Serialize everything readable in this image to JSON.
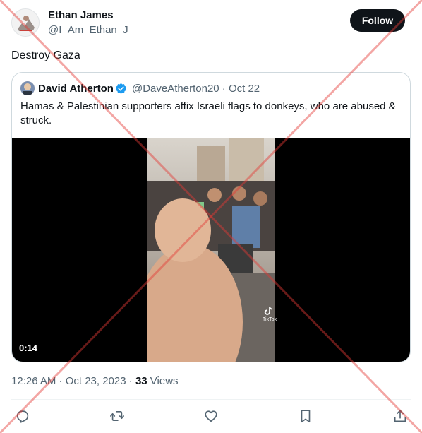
{
  "author": {
    "display_name": "Ethan James",
    "handle": "@I_Am_Ethan_J"
  },
  "follow_label": "Follow",
  "tweet_text": "Destroy Gaza",
  "quoted": {
    "display_name": "David Atherton",
    "handle_and_date": "@DaveAtherton20 · Oct 22",
    "text": "Hamas & Palestinian supporters affix Israeli flags to donkeys, who are abused & struck.",
    "video": {
      "duration": "0:14",
      "watermark": "TikTok"
    }
  },
  "meta": {
    "timestamp": "12:26 AM · Oct 23, 2023 · ",
    "views_count": "33",
    "views_label": "Views"
  },
  "actions": [
    "reply-icon",
    "retweet-icon",
    "like-icon",
    "bookmark-icon",
    "share-icon"
  ],
  "colors": {
    "accent_black": "#0f1419",
    "secondary_text": "#536471",
    "verified_blue": "#1d9bf0",
    "overlay_red": "#e53935"
  }
}
